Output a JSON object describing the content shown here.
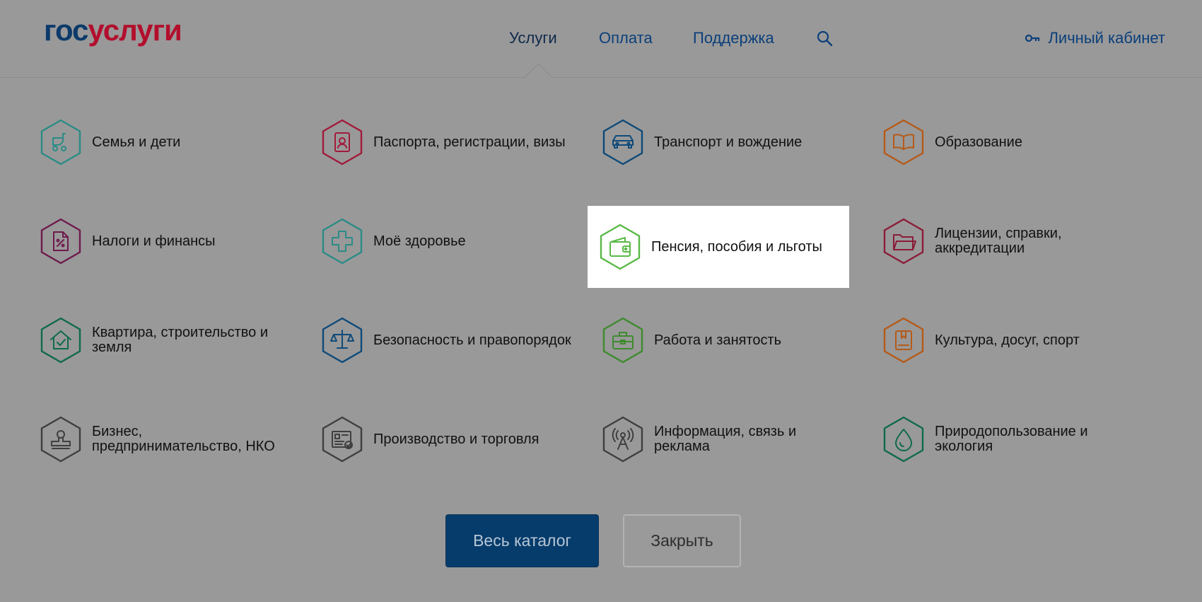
{
  "header": {
    "logo_part1": "гос",
    "logo_part2": "услуги",
    "nav": [
      "Услуги",
      "Оплата",
      "Поддержка"
    ],
    "cabinet_label": "Личный кабинет"
  },
  "categories": [
    {
      "label": "Семья и дети",
      "icon": "stroller-icon",
      "color": "#2a8b86"
    },
    {
      "label": "Паспорта, регистрации, визы",
      "icon": "passport-icon",
      "color": "#a11a3b"
    },
    {
      "label": "Транспорт и вождение",
      "icon": "car-icon",
      "color": "#0e4a79"
    },
    {
      "label": "Образование",
      "icon": "book-icon",
      "color": "#b55a19"
    },
    {
      "label": "Налоги и финансы",
      "icon": "tax-document-icon",
      "color": "#6e1a4c"
    },
    {
      "label": "Моё здоровье",
      "icon": "medical-cross-icon",
      "color": "#2a8b86"
    },
    {
      "label": "Пенсия, пособия и льготы",
      "icon": "wallet-icon",
      "color": "#5ab947"
    },
    {
      "label": "Лицензии, справки, аккредитации",
      "icon": "folder-icon",
      "color": "#8b1c39"
    },
    {
      "label": "Квартира, строительство и земля",
      "icon": "house-check-icon",
      "color": "#0f6a4a"
    },
    {
      "label": "Безопасность и правопорядок",
      "icon": "scales-icon",
      "color": "#0e4a79"
    },
    {
      "label": "Работа и занятость",
      "icon": "briefcase-icon",
      "color": "#3d8b2e"
    },
    {
      "label": "Культура, досуг, спорт",
      "icon": "culture-book-icon",
      "color": "#b55a19"
    },
    {
      "label": "Бизнес, предпринимательство, НКО",
      "icon": "stamp-icon",
      "color": "#3f3f3f"
    },
    {
      "label": "Производство и торговля",
      "icon": "certificate-icon",
      "color": "#3f3f3f"
    },
    {
      "label": "Информация, связь и реклама",
      "icon": "antenna-icon",
      "color": "#3f3f3f"
    },
    {
      "label": "Природопользование и экология",
      "icon": "water-drop-icon",
      "color": "#0f6a4a"
    }
  ],
  "buttons": {
    "catalog": "Весь каталог",
    "close": "Закрыть"
  }
}
